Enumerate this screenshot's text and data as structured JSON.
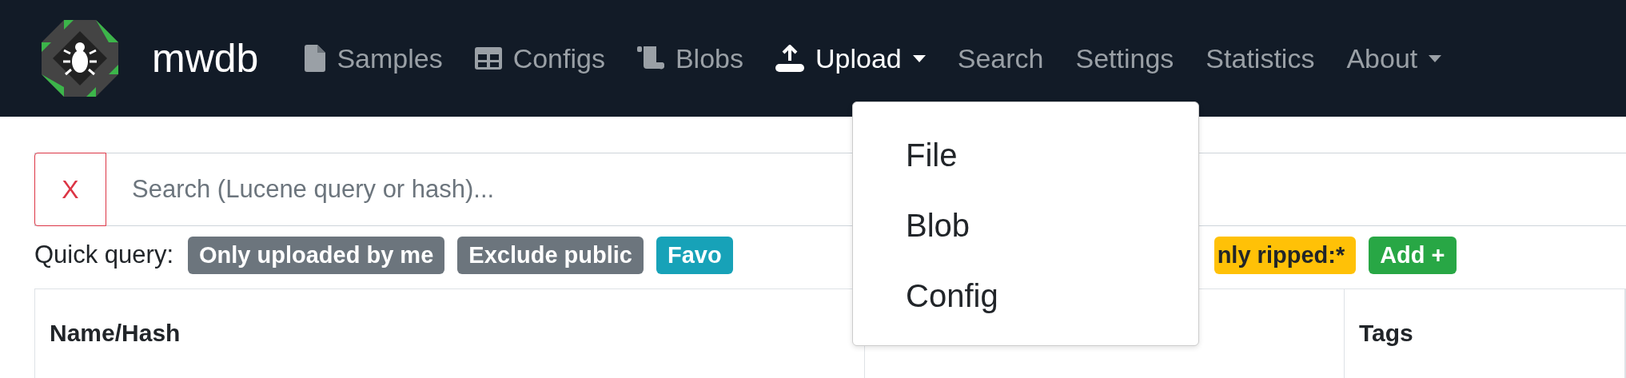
{
  "brand": {
    "name": "mwdb"
  },
  "nav": [
    {
      "label": "Samples",
      "dropdown": false,
      "selected": false
    },
    {
      "label": "Configs",
      "dropdown": false,
      "selected": false
    },
    {
      "label": "Blobs",
      "dropdown": false,
      "selected": false
    },
    {
      "label": "Upload",
      "dropdown": true,
      "selected": true
    },
    {
      "label": "Search",
      "dropdown": false,
      "selected": false
    },
    {
      "label": "Settings",
      "dropdown": false,
      "selected": false
    },
    {
      "label": "Statistics",
      "dropdown": false,
      "selected": false
    },
    {
      "label": "About",
      "dropdown": true,
      "selected": false
    }
  ],
  "upload_menu": [
    "File",
    "Blob",
    "Config"
  ],
  "search": {
    "clear": "X",
    "placeholder": "Search (Lucene query or hash)..."
  },
  "quick_query": {
    "label": "Quick query:",
    "badges": [
      {
        "text": "Only uploaded by me",
        "color": "#6c757d"
      },
      {
        "text": "Exclude public",
        "color": "#6c757d"
      },
      {
        "text": "Favo",
        "color": "#17a2b8"
      },
      {
        "text": "nly ripped:*",
        "color": "#ffc107"
      },
      {
        "text": "Add +",
        "color": "#28a745"
      }
    ]
  },
  "table": {
    "columns": [
      "Name/Hash",
      "Tags"
    ]
  }
}
